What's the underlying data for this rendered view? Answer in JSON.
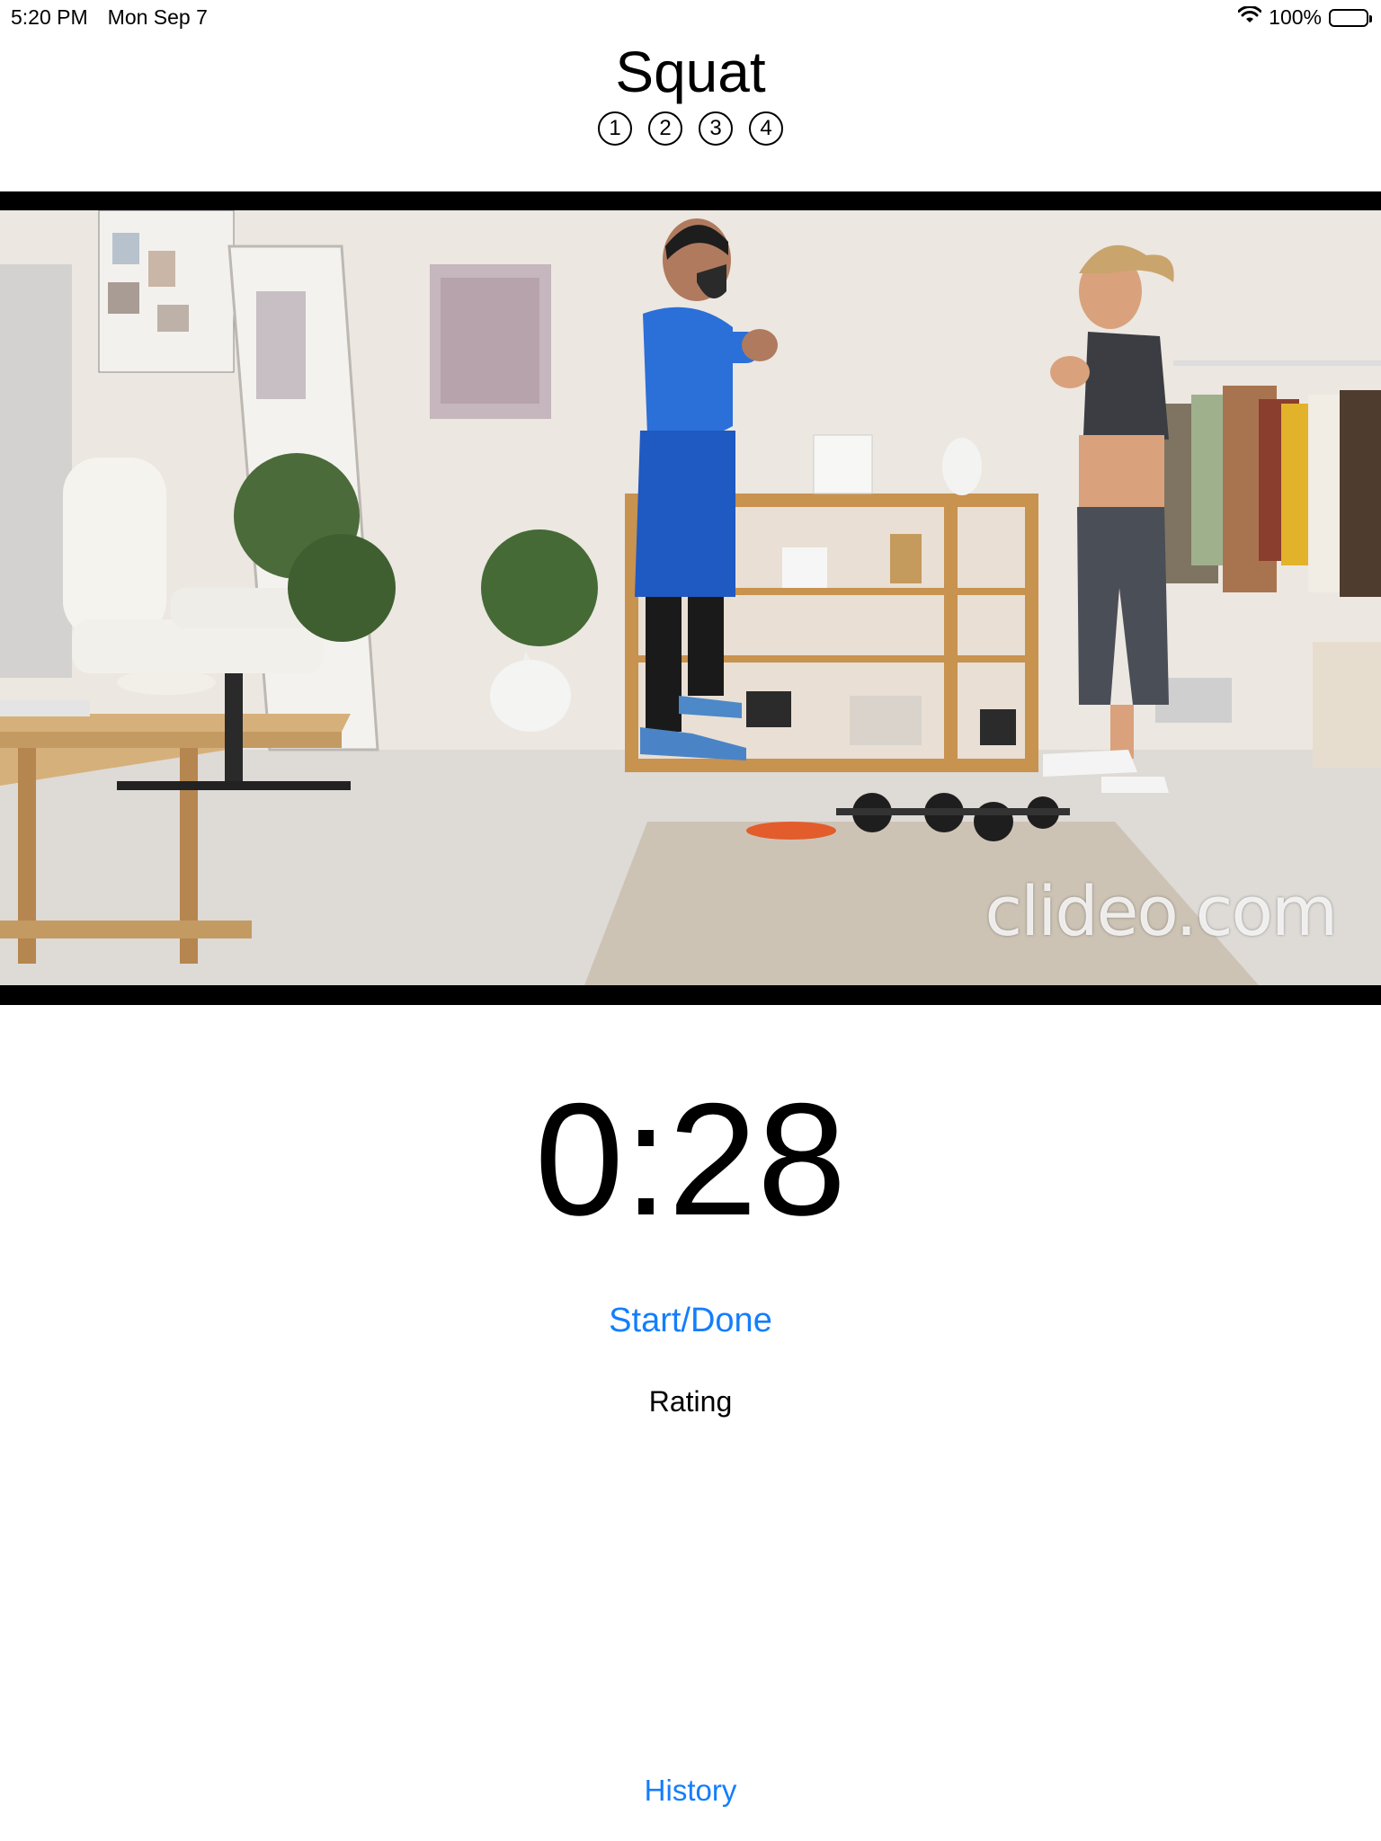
{
  "status_bar": {
    "time": "5:20 PM",
    "date": "Mon Sep 7",
    "battery": "100%",
    "icons": [
      "wifi-icon",
      "battery-icon"
    ]
  },
  "exercise": {
    "title": "Squat",
    "steps": [
      "1",
      "2",
      "3",
      "4"
    ]
  },
  "video": {
    "watermark": "clideo.com"
  },
  "timer": {
    "value": "0:28"
  },
  "actions": {
    "start_done_label": "Start/Done",
    "rating_label": "Rating",
    "history_label": "History"
  },
  "colors": {
    "accent": "#147efb",
    "text": "#000000",
    "background": "#ffffff"
  }
}
